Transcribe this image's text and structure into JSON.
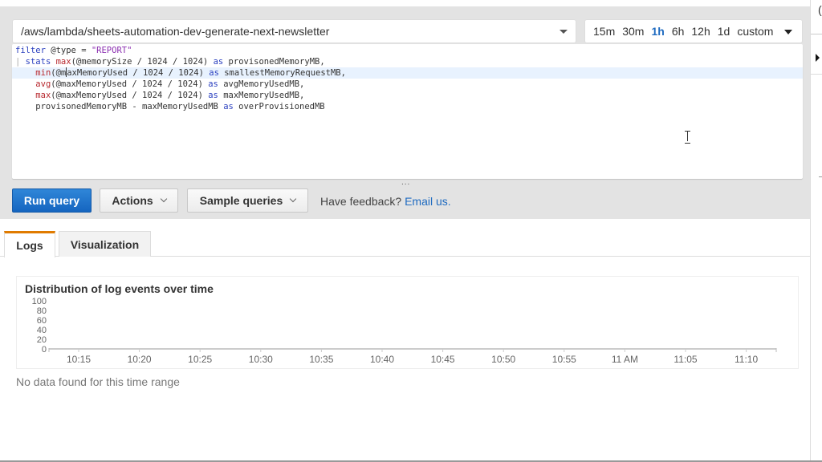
{
  "log_group": {
    "selected": "/aws/lambda/sheets-automation-dev-generate-next-newsletter"
  },
  "time_range": {
    "options": [
      "15m",
      "30m",
      "1h",
      "6h",
      "12h",
      "1d",
      "custom"
    ],
    "selected": "1h"
  },
  "editor": {
    "lines": [
      {
        "parts": [
          {
            "t": "filter",
            "c": "kw"
          },
          {
            "t": " @type = ",
            "c": ""
          },
          {
            "t": "\"REPORT\"",
            "c": "str"
          }
        ]
      },
      {
        "parts": [
          {
            "t": "| ",
            "c": "gutter"
          },
          {
            "t": "stats",
            "c": "kw"
          },
          {
            "t": " ",
            "c": ""
          },
          {
            "t": "max",
            "c": "fn"
          },
          {
            "t": "(@memorySize / 1024 / 1024) ",
            "c": ""
          },
          {
            "t": "as",
            "c": "kw"
          },
          {
            "t": " provisonedMemoryMB,",
            "c": ""
          }
        ]
      },
      {
        "parts": [
          {
            "t": "    ",
            "c": ""
          },
          {
            "t": "min",
            "c": "fn"
          },
          {
            "t": "(@m",
            "c": ""
          },
          {
            "t": "|",
            "c": "caret"
          },
          {
            "t": "axMemoryUsed / 1024 / 1024) ",
            "c": ""
          },
          {
            "t": "as",
            "c": "kw"
          },
          {
            "t": " smallestMemoryRequestMB,",
            "c": ""
          }
        ],
        "highlight": true
      },
      {
        "parts": [
          {
            "t": "    ",
            "c": ""
          },
          {
            "t": "avg",
            "c": "fn"
          },
          {
            "t": "(@maxMemoryUsed / 1024 / 1024) ",
            "c": ""
          },
          {
            "t": "as",
            "c": "kw"
          },
          {
            "t": " avgMemoryUsedMB,",
            "c": ""
          }
        ]
      },
      {
        "parts": [
          {
            "t": "    ",
            "c": ""
          },
          {
            "t": "max",
            "c": "fn"
          },
          {
            "t": "(@maxMemoryUsed / 1024 / 1024) ",
            "c": ""
          },
          {
            "t": "as",
            "c": "kw"
          },
          {
            "t": " maxMemoryUsedMB,",
            "c": ""
          }
        ]
      },
      {
        "parts": [
          {
            "t": "    provisonedMemoryMB - maxMemoryUsedMB ",
            "c": ""
          },
          {
            "t": "as",
            "c": "kw"
          },
          {
            "t": " overProvisionedMB",
            "c": ""
          }
        ]
      }
    ],
    "resize_handle": "..."
  },
  "toolbar": {
    "run_label": "Run query",
    "actions_label": "Actions",
    "sample_label": "Sample queries",
    "feedback_text": "Have feedback?",
    "feedback_link": "Email us."
  },
  "tabs": [
    {
      "label": "Logs",
      "active": true
    },
    {
      "label": "Visualization",
      "active": false
    }
  ],
  "chart_data": {
    "type": "bar",
    "title": "Distribution of log events over time",
    "xlabel": "",
    "ylabel": "",
    "categories": [
      "10:15",
      "10:20",
      "10:25",
      "10:30",
      "10:35",
      "10:40",
      "10:45",
      "10:50",
      "10:55",
      "11 AM",
      "11:05",
      "11:10"
    ],
    "values": [],
    "yticks": [
      0,
      20,
      40,
      60,
      80,
      100
    ],
    "ylim": [
      0,
      100
    ],
    "grid": false
  },
  "empty_message": "No data found for this time range",
  "colors": {
    "primary": "#1565c0",
    "link": "#1f6bc0",
    "tab_accent": "#e07b00",
    "keyword": "#2a3fbf",
    "function": "#b8292f",
    "string": "#8b2fb0"
  }
}
